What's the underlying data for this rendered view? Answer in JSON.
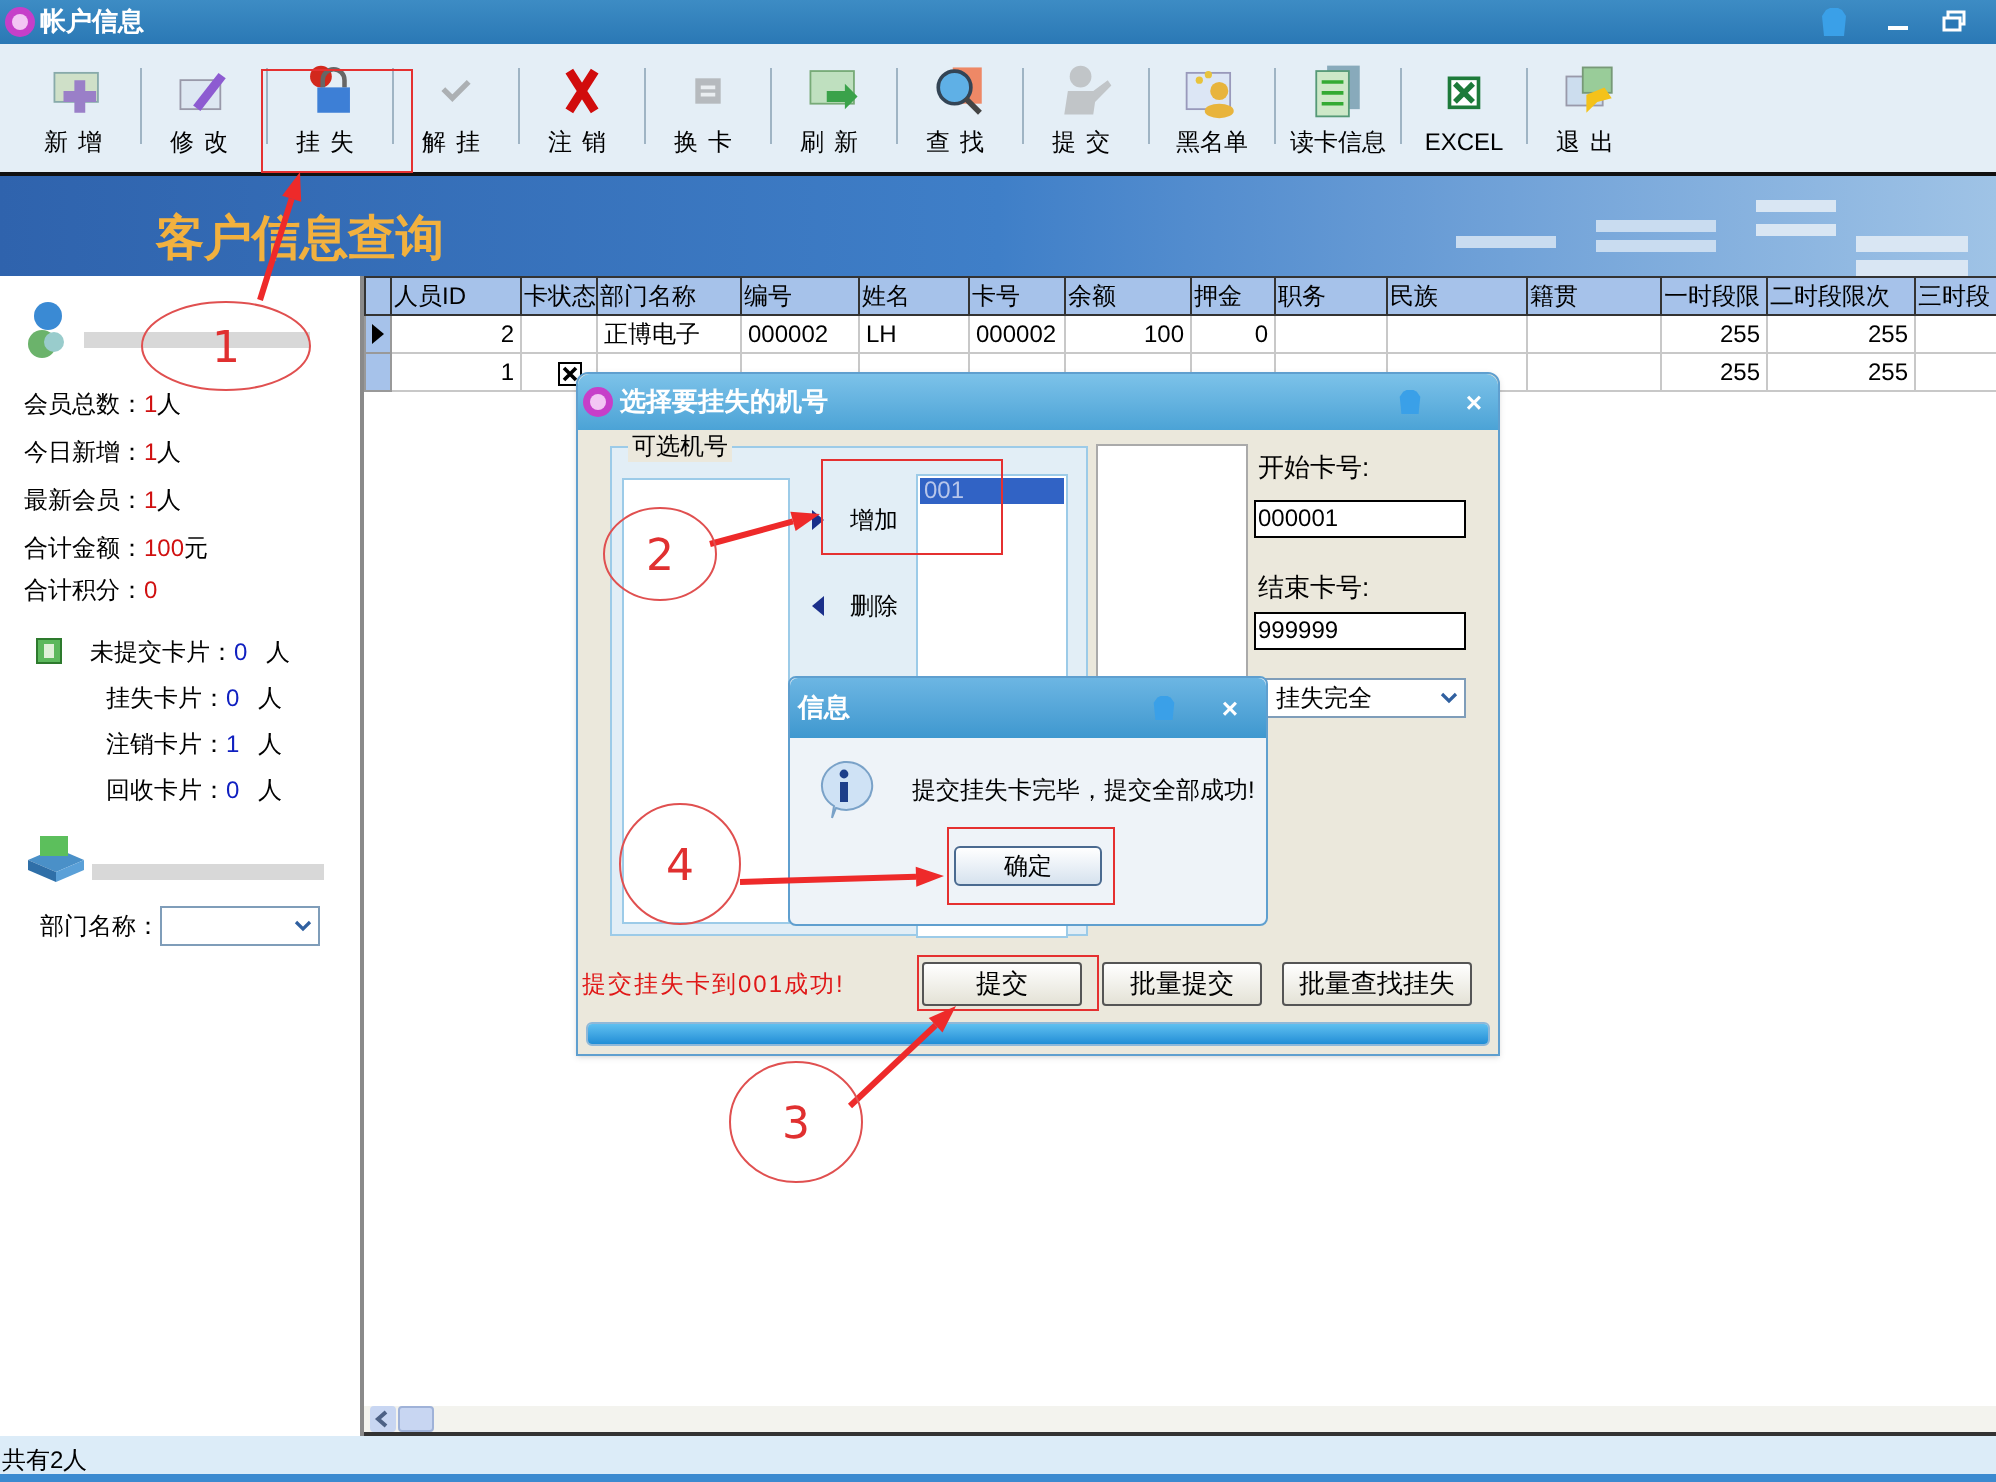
{
  "window": {
    "title": "帐户信息"
  },
  "toolbar": [
    {
      "label": "新增",
      "disabled": false
    },
    {
      "label": "修改",
      "disabled": false
    },
    {
      "label": "挂失",
      "disabled": false
    },
    {
      "label": "解挂",
      "disabled": true
    },
    {
      "label": "注销",
      "disabled": false
    },
    {
      "label": "换卡",
      "disabled": true
    },
    {
      "label": "刷新",
      "disabled": false
    },
    {
      "label": "查找",
      "disabled": false
    },
    {
      "label": "提交",
      "disabled": true
    },
    {
      "label": "黑名单",
      "disabled": false
    },
    {
      "label": "读卡信息",
      "disabled": false
    },
    {
      "label": "EXCEL",
      "disabled": false
    },
    {
      "label": "退出",
      "disabled": false
    }
  ],
  "banner": {
    "title": "客户信息查询"
  },
  "summary": {
    "stats": [
      {
        "label": "会员总数：",
        "value": "1",
        "unit": "人"
      },
      {
        "label": "今日新增：",
        "value": "1",
        "unit": "人"
      },
      {
        "label": "最新会员：",
        "value": "1",
        "unit": "人"
      },
      {
        "label": "合计金额：",
        "value": "100",
        "unit": "元"
      },
      {
        "label": "合计积分：",
        "value": "0"
      }
    ],
    "cards": [
      {
        "label": "未提交卡片：",
        "value": "0",
        "unit": "人"
      },
      {
        "label": "挂失卡片：",
        "value": "0",
        "unit": "人"
      },
      {
        "label": "注销卡片：",
        "value": "1",
        "unit": "人"
      },
      {
        "label": "回收卡片：",
        "value": "0",
        "unit": "人"
      }
    ],
    "department": {
      "label": "部门名称："
    }
  },
  "table": {
    "columns": [
      "人员ID",
      "卡状态",
      "部门名称",
      "编号",
      "姓名",
      "卡号",
      "余额",
      "押金",
      "职务",
      "民族",
      "籍贯",
      "一时段限",
      "二时段限次",
      "三时段"
    ],
    "rows": [
      {
        "selected": true,
        "card_checked": false,
        "cells": [
          "2",
          "",
          "正博电子",
          "000002",
          "LH",
          "000002",
          "100",
          "0",
          "",
          "",
          "",
          "255",
          "255",
          ""
        ]
      },
      {
        "selected": false,
        "card_checked": true,
        "cells": [
          "1",
          "",
          "",
          "",
          "",
          "",
          "",
          "",
          "",
          "",
          "",
          "255",
          "255",
          ""
        ]
      }
    ]
  },
  "status_bar": "共有2人",
  "dialog": {
    "title": "选择要挂失的机号",
    "close": "×",
    "group_label": "可选机号",
    "add_button": "增加",
    "remove_button": "删除",
    "machines": [
      {
        "label": "001",
        "selected": true
      }
    ],
    "start_label": "开始卡号:",
    "start_value": "000001",
    "end_label": "结束卡号:",
    "end_value": "999999",
    "mode_value": "挂失完全",
    "status_message": "提交挂失卡到001成功!",
    "buttons": [
      "提交",
      "批量提交",
      "批量查找挂失"
    ],
    "progress": {
      "level": 1
    }
  },
  "message_box": {
    "title": "信息",
    "close": "×",
    "message": "提交挂失卡完毕，提交全部成功!",
    "ok": "确定"
  },
  "annotations": [
    {
      "label": "1"
    },
    {
      "label": "2"
    },
    {
      "label": "3"
    },
    {
      "label": "4"
    }
  ]
}
